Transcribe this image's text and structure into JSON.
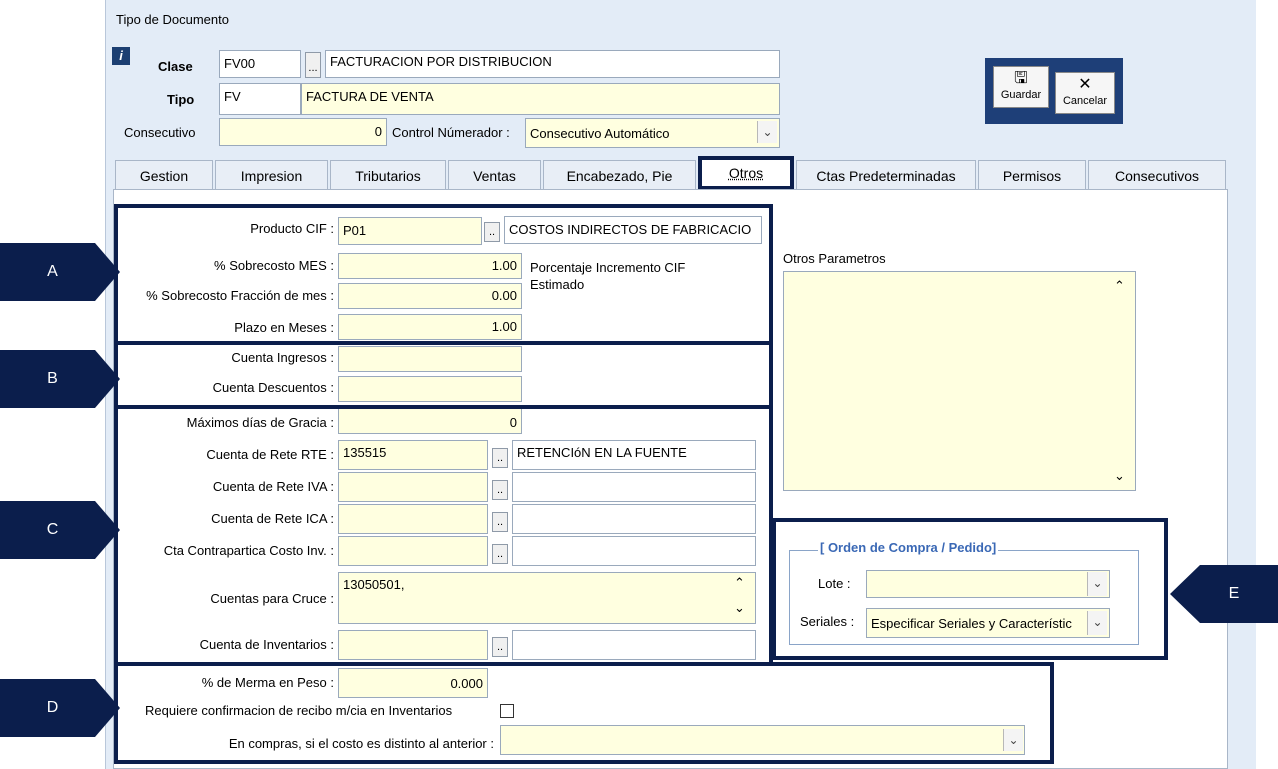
{
  "window": {
    "title": "Tipo de Documento"
  },
  "header": {
    "clase_label": "Clase",
    "clase_code": "FV00",
    "clase_btn": "...",
    "clase_desc": "FACTURACION POR DISTRIBUCION",
    "tipo_label": "Tipo",
    "tipo_code": "FV",
    "tipo_desc": "FACTURA DE VENTA",
    "consecutivo_label": "Consecutivo",
    "consecutivo_value": "0",
    "control_label": "Control Númerador :",
    "control_value": "Consecutivo Automático"
  },
  "toolbar": {
    "save_label": "Guardar",
    "cancel_label": "Cancelar",
    "save_icon": "floppy-icon",
    "cancel_icon": "x-icon"
  },
  "tabs": [
    "Gestion",
    "Impresion",
    "Tributarios",
    "Ventas",
    "Encabezado, Pie",
    "Otros",
    "Ctas Predeterminadas",
    "Permisos",
    "Consecutivos"
  ],
  "active_tab": "Otros",
  "callouts": {
    "a": "A",
    "b": "B",
    "c": "C",
    "d": "D",
    "e": "E"
  },
  "section_a": {
    "producto_cif_label": "Producto CIF :",
    "producto_cif_value": "P01",
    "producto_cif_btn": "..",
    "producto_cif_desc": "COSTOS INDIRECTOS DE FABRICACIO",
    "sobrecosto_mes_label": "% Sobrecosto MES :",
    "sobrecosto_mes_value": "1.00",
    "sobrecosto_frac_label": "% Sobrecosto Fracción de mes :",
    "sobrecosto_frac_value": "0.00",
    "plazo_label": "Plazo en Meses :",
    "plazo_value": "1.00",
    "note": "Porcentaje Incremento CIF Estimado"
  },
  "section_b": {
    "ingresos_label": "Cuenta Ingresos :",
    "ingresos_value": "",
    "descuentos_label": "Cuenta Descuentos :",
    "descuentos_value": ""
  },
  "section_c": {
    "gracia_label": "Máximos días de Gracia :",
    "gracia_value": "0",
    "rte_label": "Cuenta de Rete RTE :",
    "rte_value": "135515",
    "rte_btn": "..",
    "rte_desc": "RETENCIóN EN LA FUENTE",
    "iva_label": "Cuenta de Rete IVA :",
    "iva_btn": "..",
    "ica_label": "Cuenta de Rete ICA :",
    "ica_btn": "..",
    "contra_label": "Cta Contrapartica Costo Inv. :",
    "contra_btn": "..",
    "cruce_label": "Cuentas para Cruce :",
    "cruce_value": "13050501,",
    "inventarios_label": "Cuenta de Inventarios :",
    "inventarios_btn": ".."
  },
  "section_d": {
    "merma_label": "% de Merma en Peso :",
    "merma_value": "0.000",
    "confirm_label": "Requiere confirmacion de recibo  m/cia  en Inventarios",
    "confirm_checked": false,
    "compras_label": "En compras, si el costo es distinto al anterior :",
    "compras_value": ""
  },
  "otros_parametros": {
    "label": "Otros Parametros",
    "value": ""
  },
  "section_e": {
    "group_title": "[ Orden de Compra  / Pedido]",
    "lote_label": "Lote :",
    "lote_value": "",
    "seriales_label": "Seriales :",
    "seriales_value": "Especificar Seriales y Característic"
  },
  "colors": {
    "callout": "#0b1e4c",
    "field_bg": "#ffffe0",
    "group_title": "#3a68b5"
  }
}
